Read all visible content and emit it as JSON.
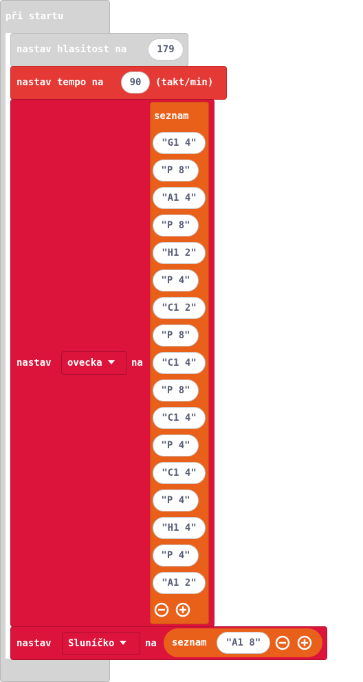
{
  "on_start": {
    "label": "při startu"
  },
  "set_volume": {
    "label": "nastav hlasitost na",
    "value": "179"
  },
  "set_tempo": {
    "label": "nastav tempo na",
    "value": "90",
    "unit": "(takt/min)"
  },
  "set_ovecka": {
    "label": "nastav",
    "variable": "ovecka",
    "to_label": "na",
    "list_label": "seznam",
    "items": [
      "\"G1 4\"",
      "\"P 8\"",
      "\"A1 4\"",
      "\"P 8\"",
      "\"H1 2\"",
      "\"P 4\"",
      "\"C1 2\"",
      "\"P 8\"",
      "\"C1 4\"",
      "\"P 8\"",
      "\"C1 4\"",
      "\"P 4\"",
      "\"C1 4\"",
      "\"P 4\"",
      "\"H1 4\"",
      "\"P 4\"",
      "\"A1 2\""
    ]
  },
  "set_slunicko": {
    "label": "nastav",
    "variable": "Sluníčko",
    "to_label": "na",
    "list_label": "seznam",
    "items": [
      "\"A1 8\""
    ]
  },
  "icons": {
    "remove": "minus-circle-icon",
    "add": "plus-circle-icon",
    "dropdown": "caret-down-icon"
  },
  "colors": {
    "events": "#d4d4d4",
    "music": "#e53935",
    "variables": "#dc143c",
    "lists": "#e8601a"
  }
}
